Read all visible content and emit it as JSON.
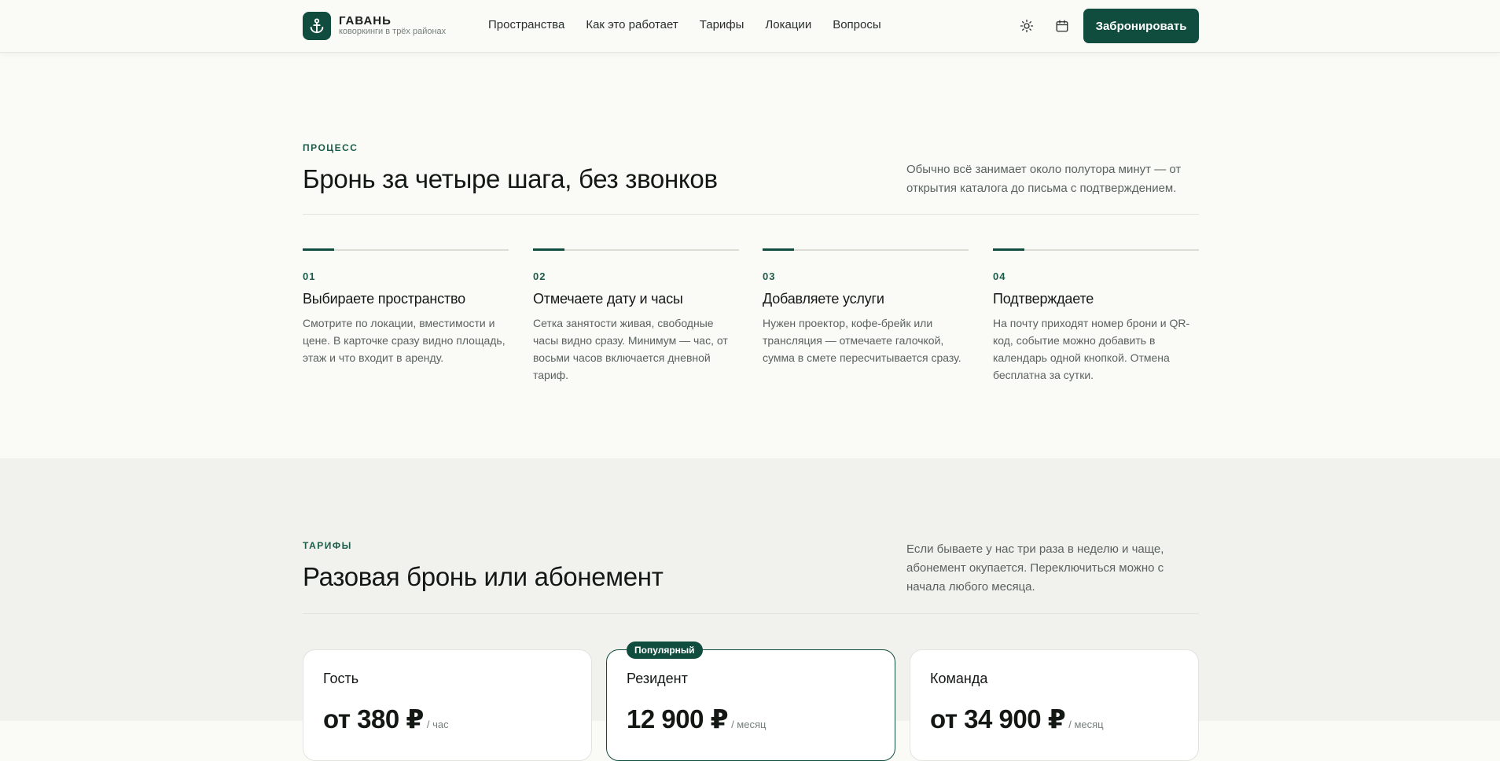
{
  "header": {
    "logo_title": "ГАВАНЬ",
    "logo_subtitle": "коворкинги в трёх районах",
    "logo_icon": "anchor-icon",
    "nav": [
      "Пространства",
      "Как это работает",
      "Тарифы",
      "Локации",
      "Вопросы"
    ],
    "theme_icon": "sun-icon",
    "calendar_icon": "calendar-icon",
    "book_label": "Забронировать"
  },
  "process": {
    "eyebrow": "ПРОЦЕСС",
    "title": "Бронь за четыре шага, без звонков",
    "aside": "Обычно всё занимает около полутора минут — от открытия каталога до письма с подтверждением.",
    "steps": [
      {
        "num": "01",
        "title": "Выбираете пространство",
        "text": "Смотрите по локации, вместимости и цене. В карточке сразу видно площадь, этаж и что входит в аренду."
      },
      {
        "num": "02",
        "title": "Отмечаете дату и часы",
        "text": "Сетка занятости живая, свободные часы видно сразу. Минимум — час, от восьми часов включается дневной тариф."
      },
      {
        "num": "03",
        "title": "Добавляете услуги",
        "text": "Нужен проектор, кофе-брейк или трансляция — отмечаете галочкой, сумма в смете пересчитывается сразу."
      },
      {
        "num": "04",
        "title": "Подтверждаете",
        "text": "На почту приходят номер брони и QR-код, событие можно добавить в календарь одной кнопкой. Отмена бесплатна за сутки."
      }
    ]
  },
  "tariffs": {
    "eyebrow": "ТАРИФЫ",
    "title": "Разовая бронь или абонемент",
    "aside": "Если бываете у нас три раза в неделю и чаще, абонемент окупается. Переключиться можно с начала любого месяца.",
    "cards": [
      {
        "name": "Гость",
        "price": "от 380 ₽",
        "unit": "/ час",
        "badge": ""
      },
      {
        "name": "Резидент",
        "price": "12 900 ₽",
        "unit": "/ месяц",
        "badge": "Популярный"
      },
      {
        "name": "Команда",
        "price": "от 34 900 ₽",
        "unit": "/ месяц",
        "badge": ""
      }
    ]
  },
  "colors": {
    "accent": "#114d3f",
    "background": "#fafaf7",
    "section_alt": "#f1f1ed"
  }
}
